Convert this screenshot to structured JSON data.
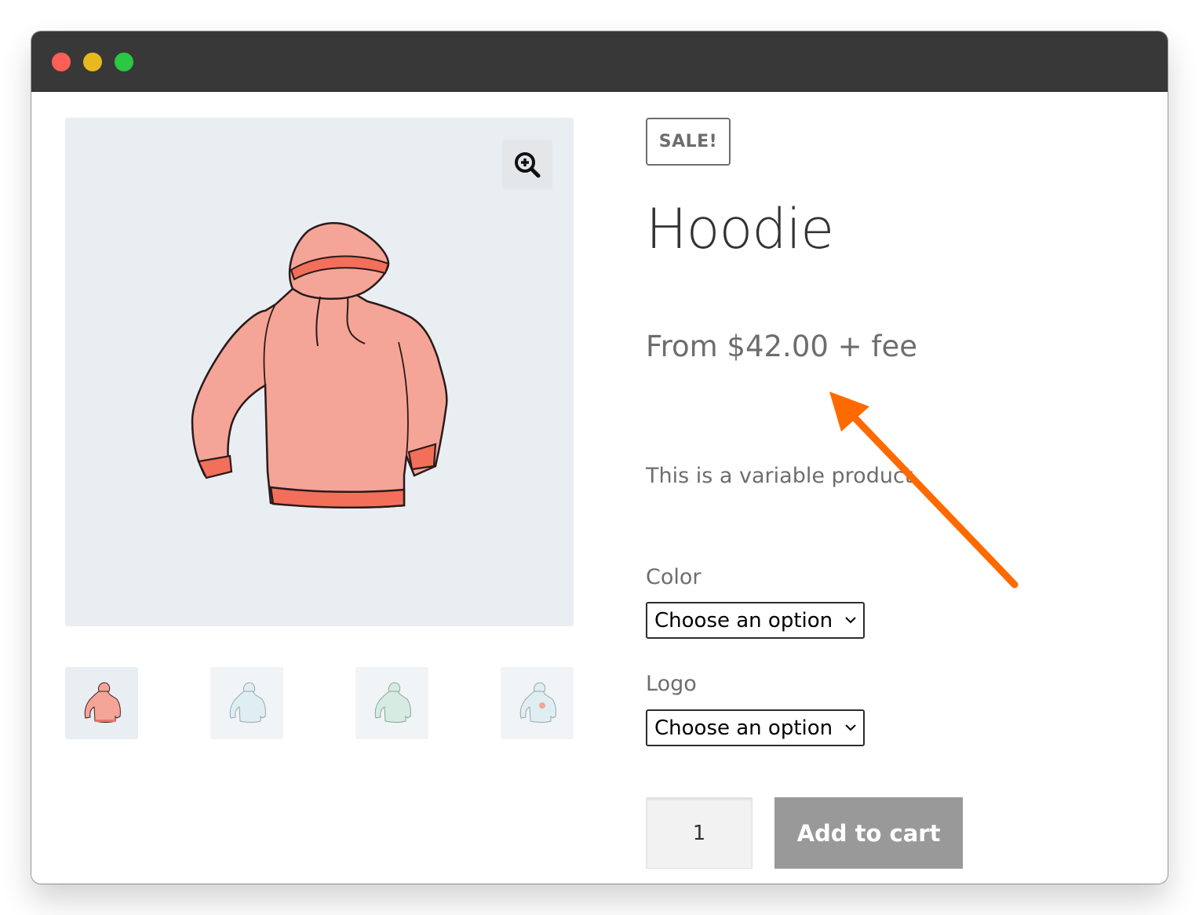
{
  "product": {
    "sale_badge": "SALE!",
    "title": "Hoodie",
    "price": "From $42.00 + fee",
    "description": "This is a variable product."
  },
  "attributes": [
    {
      "label": "Color",
      "selected": "Choose an option"
    },
    {
      "label": "Logo",
      "selected": "Choose an option"
    }
  ],
  "cart": {
    "quantity": "1",
    "add_label": "Add to cart"
  },
  "gallery": {
    "thumbnails": [
      "hoodie-red",
      "hoodie-blue",
      "hoodie-green",
      "hoodie-logo"
    ]
  },
  "colors": {
    "hoodie_main": "#f4a597",
    "hoodie_trim": "#f26f5a",
    "sale_text": "#6d6d6d",
    "button": "#999999",
    "arrow": "#ff6a00",
    "titlebar": "#383838"
  }
}
